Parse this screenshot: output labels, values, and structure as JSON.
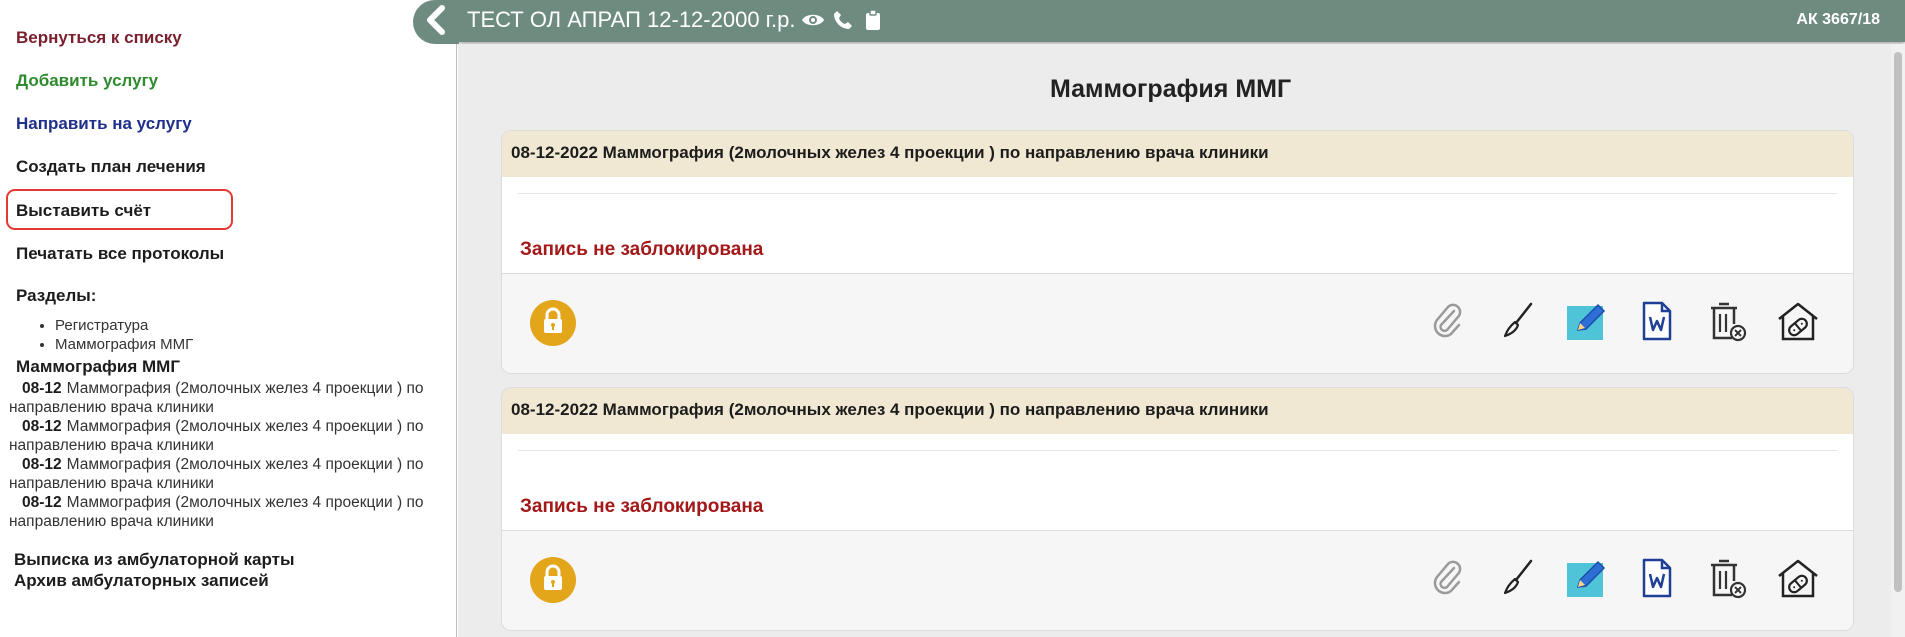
{
  "sidebar": {
    "back_label": "Вернуться к списку",
    "add_label": "Добавить услугу",
    "refer_label": "Направить на услугу",
    "plan_label": "Создать план лечения",
    "bill_label": "Выставить счёт",
    "print_label": "Печатать все протоколы",
    "sections_heading": "Разделы:",
    "sections": [
      "Регистратура",
      "Маммография ММГ"
    ],
    "sub_heading": "Маммография ММГ",
    "entries": [
      {
        "date": "08-12",
        "text": "Маммография (2молочных желез 4 проекции ) по направлению врача клиники"
      },
      {
        "date": "08-12",
        "text": "Маммография (2молочных желез 4 проекции ) по направлению врача клиники"
      },
      {
        "date": "08-12",
        "text": "Маммография (2молочных желез 4 проекции ) по направлению врача клиники"
      },
      {
        "date": "08-12",
        "text": "Маммография (2молочных желез 4 проекции ) по направлению врача клиники"
      }
    ],
    "extract_label": "Выписка из амбулаторной карты",
    "archive_label": "Архив амбулаторных записей"
  },
  "header": {
    "patient": "ТЕСТ ОЛ АПРАП 12-12-2000 г.р.",
    "card_number": "АК 3667/18",
    "icons": [
      "eye-icon",
      "phone-icon",
      "clipboard-icon"
    ],
    "bar_color": "#6e8b80"
  },
  "main": {
    "title": "Маммография ММГ",
    "records": [
      {
        "header": "08-12-2022 Маммография (2молочных желез 4 проекции ) по направлению врача клиники",
        "status": "Запись не заблокирована"
      },
      {
        "header": "08-12-2022 Маммография (2молочных желез 4 проекции ) по направлению врача клиники",
        "status": "Запись не заблокирована"
      }
    ],
    "tools": [
      "lock-icon",
      "paperclip-icon",
      "brush-icon",
      "edit-icon",
      "word-doc-icon",
      "delete-icon",
      "medical-house-icon"
    ],
    "colors": {
      "status": "#a31818",
      "lock": "#e3a51a",
      "card_header": "#f0e8d2",
      "highlight": "#e53935"
    }
  }
}
